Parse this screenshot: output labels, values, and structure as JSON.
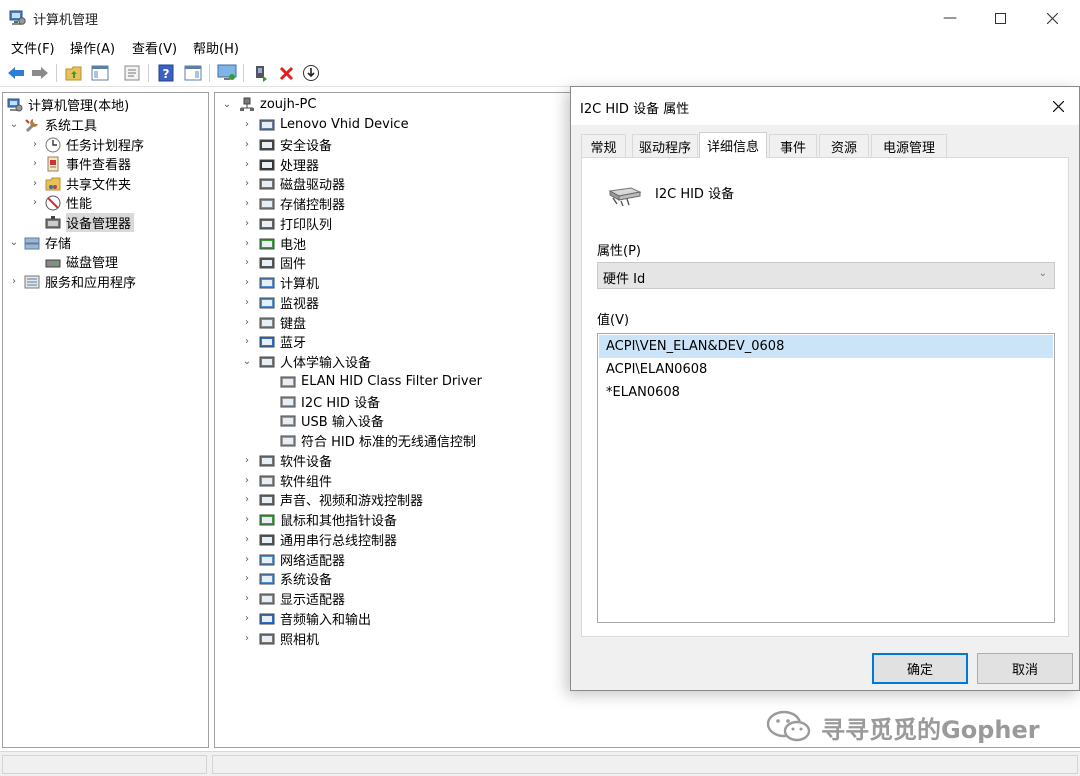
{
  "window": {
    "title": "计算机管理",
    "icon": "computer-management-icon"
  },
  "menu": [
    "文件(F)",
    "操作(A)",
    "查看(V)",
    "帮助(H)"
  ],
  "toolbar": {
    "icons": [
      "back-arrow-icon",
      "forward-arrow-icon",
      "up-folder-icon",
      "show-hide-tree-icon",
      "properties-icon",
      "help-icon",
      "action-pane-icon",
      "monitor-icon",
      "update-driver-icon",
      "uninstall-device-icon",
      "disable-device-icon"
    ]
  },
  "left_tree": {
    "root": "计算机管理(本地)",
    "system_tools": "系统工具",
    "task_scheduler": "任务计划程序",
    "event_viewer": "事件查看器",
    "shared_folders": "共享文件夹",
    "performance": "性能",
    "device_manager": "设备管理器",
    "storage": "存储",
    "disk_management": "磁盘管理",
    "services_apps": "服务和应用程序"
  },
  "device_tree": {
    "computer_name": "zoujh-PC",
    "categories": [
      "Lenovo Vhid Device",
      "安全设备",
      "处理器",
      "磁盘驱动器",
      "存储控制器",
      "打印队列",
      "电池",
      "固件",
      "计算机",
      "监视器",
      "键盘",
      "蓝牙",
      "人体学输入设备"
    ],
    "hid_children": [
      "ELAN HID Class Filter Driver",
      "I2C HID 设备",
      "USB 输入设备",
      "符合 HID 标准的无线通信控制"
    ],
    "categories_after": [
      "软件设备",
      "软件组件",
      "声音、视频和游戏控制器",
      "鼠标和其他指针设备",
      "通用串行总线控制器",
      "网络适配器",
      "系统设备",
      "显示适配器",
      "音频输入和输出",
      "照相机"
    ]
  },
  "dialog": {
    "title": "I2C HID 设备 属性",
    "tabs": [
      "常规",
      "驱动程序",
      "详细信息",
      "事件",
      "资源",
      "电源管理"
    ],
    "active_tab": "详细信息",
    "device_name": "I2C HID 设备",
    "property_label": "属性(P)",
    "property_value": "硬件 Id",
    "value_label": "值(V)",
    "values": [
      "ACPI\\VEN_ELAN&DEV_0608",
      "ACPI\\ELAN0608",
      "*ELAN0608"
    ],
    "ok": "确定",
    "cancel": "取消"
  },
  "watermark": "寻寻觅觅的Gopher",
  "colors": {
    "accent": "#0078d7",
    "selection": "#cce4f7",
    "tree_selection": "#d9d9d9"
  }
}
